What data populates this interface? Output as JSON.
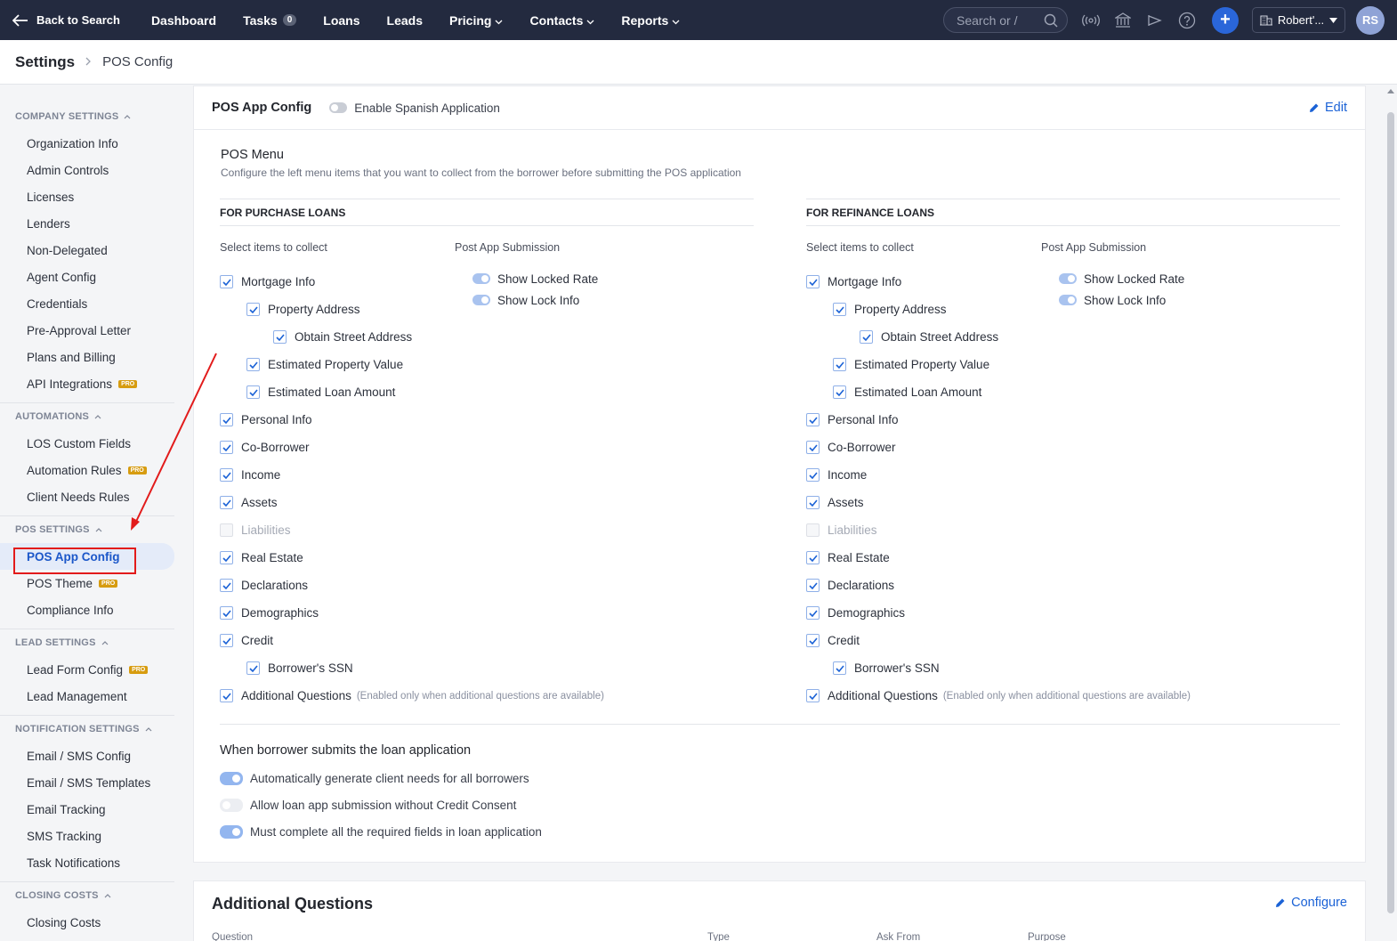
{
  "nav": {
    "back_label": "Back to Search",
    "links": [
      {
        "label": "Dashboard"
      },
      {
        "label": "Tasks",
        "badge": "0"
      },
      {
        "label": "Loans"
      },
      {
        "label": "Leads"
      },
      {
        "label": "Pricing",
        "dropdown": true
      },
      {
        "label": "Contacts",
        "dropdown": true
      },
      {
        "label": "Reports",
        "dropdown": true
      }
    ],
    "search_placeholder": "Search or /",
    "icons": [
      "broadcast-icon",
      "bank-icon",
      "announcement-icon",
      "help-icon"
    ],
    "plus": "+",
    "user_name": "Robert'...",
    "avatar_initials": "RS"
  },
  "breadcrumb": {
    "root": "Settings",
    "current": "POS Config"
  },
  "sidebar": {
    "sections": [
      {
        "title": "COMPANY SETTINGS",
        "items": [
          {
            "label": "Organization Info"
          },
          {
            "label": "Admin Controls"
          },
          {
            "label": "Licenses"
          },
          {
            "label": "Lenders"
          },
          {
            "label": "Non-Delegated"
          },
          {
            "label": "Agent Config"
          },
          {
            "label": "Credentials"
          },
          {
            "label": "Pre-Approval Letter"
          },
          {
            "label": "Plans and Billing"
          },
          {
            "label": "API Integrations",
            "pro": true
          }
        ]
      },
      {
        "title": "AUTOMATIONS",
        "items": [
          {
            "label": "LOS Custom Fields"
          },
          {
            "label": "Automation Rules",
            "pro": true
          },
          {
            "label": "Client Needs Rules"
          }
        ]
      },
      {
        "title": "POS SETTINGS",
        "items": [
          {
            "label": "POS App Config",
            "active": true
          },
          {
            "label": "POS Theme",
            "pro": true
          },
          {
            "label": "Compliance Info"
          }
        ]
      },
      {
        "title": "LEAD SETTINGS",
        "items": [
          {
            "label": "Lead Form Config",
            "pro": true
          },
          {
            "label": "Lead Management"
          }
        ]
      },
      {
        "title": "NOTIFICATION SETTINGS",
        "items": [
          {
            "label": "Email / SMS Config"
          },
          {
            "label": "Email / SMS Templates"
          },
          {
            "label": "Email Tracking"
          },
          {
            "label": "SMS Tracking"
          },
          {
            "label": "Task Notifications"
          }
        ]
      },
      {
        "title": "CLOSING COSTS",
        "items": [
          {
            "label": "Closing Costs"
          }
        ]
      }
    ],
    "pro_label": "PRO"
  },
  "pos_card": {
    "title": "POS App Config",
    "spanish_toggle_label": "Enable Spanish Application",
    "spanish_enabled": false,
    "edit_label": "Edit",
    "menu_title": "POS Menu",
    "menu_desc": "Configure the left menu items that you want to collect from the borrower before submitting the POS application",
    "select_label": "Select items to collect",
    "post_label": "Post App Submission",
    "columns": [
      {
        "heading": "FOR PURCHASE LOANS"
      },
      {
        "heading": "FOR REFINANCE LOANS"
      }
    ],
    "items": [
      {
        "label": "Mortgage Info",
        "level": 0,
        "checked": true
      },
      {
        "label": "Property Address",
        "level": 1,
        "checked": true
      },
      {
        "label": "Obtain Street Address",
        "level": 2,
        "checked": true
      },
      {
        "label": "Estimated Property Value",
        "level": 1,
        "checked": true
      },
      {
        "label": "Estimated Loan Amount",
        "level": 1,
        "checked": true
      },
      {
        "label": "Personal Info",
        "level": 0,
        "checked": true
      },
      {
        "label": "Co-Borrower",
        "level": 0,
        "checked": true
      },
      {
        "label": "Income",
        "level": 0,
        "checked": true
      },
      {
        "label": "Assets",
        "level": 0,
        "checked": true
      },
      {
        "label": "Liabilities",
        "level": 0,
        "checked": false,
        "disabled": true
      },
      {
        "label": "Real Estate",
        "level": 0,
        "checked": true
      },
      {
        "label": "Declarations",
        "level": 0,
        "checked": true
      },
      {
        "label": "Demographics",
        "level": 0,
        "checked": true
      },
      {
        "label": "Credit",
        "level": 0,
        "checked": true
      },
      {
        "label": "Borrower's SSN",
        "level": 1,
        "checked": true
      },
      {
        "label": "Additional Questions",
        "level": 0,
        "checked": true,
        "note": "(Enabled only when additional questions are available)"
      }
    ],
    "post_items": [
      {
        "label": "Show Locked Rate",
        "enabled": true
      },
      {
        "label": "Show Lock Info",
        "enabled": true
      }
    ],
    "submit_title": "When borrower submits the loan application",
    "submit_options": [
      {
        "label": "Automatically generate client needs for all borrowers",
        "enabled": true
      },
      {
        "label": "Allow loan app submission without Credit Consent",
        "enabled": false
      },
      {
        "label": "Must complete all the required fields in loan application",
        "enabled": true
      }
    ]
  },
  "aq_card": {
    "title": "Additional Questions",
    "configure_label": "Configure",
    "columns": [
      "Question",
      "Type",
      "Ask From",
      "Purpose"
    ]
  },
  "colors": {
    "accent": "#1b62d6",
    "nav_bg": "#232a3f",
    "highlight": "#e21b1b",
    "pro": "#d79c10"
  }
}
